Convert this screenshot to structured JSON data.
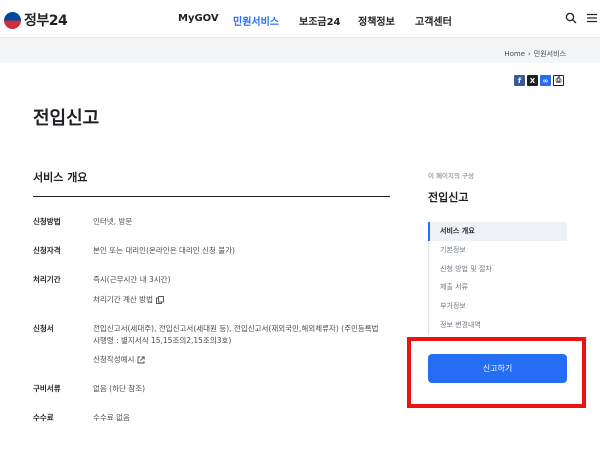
{
  "header": {
    "logo_text": "정부24",
    "nav": [
      "MyGOV",
      "민원서비스",
      "보조금24",
      "정책정보",
      "고객센터"
    ],
    "active_nav": "민원서비스",
    "icons": [
      "search-icon",
      "menu-icon"
    ]
  },
  "breadcrumb": [
    "Home",
    "민원서비스"
  ],
  "share_icons": [
    "facebook-icon",
    "x-icon",
    "link-icon",
    "print-icon"
  ],
  "page_title": "전입신고",
  "overview": {
    "section_title": "서비스 개요",
    "rows": [
      {
        "label": "신청방법",
        "value": "인터넷, 방문"
      },
      {
        "label": "신청자격",
        "value": "본인 또는 대리인(온라인은 대리인 신청 불가)"
      },
      {
        "label": "처리기간",
        "value": "즉시(근무시간 내 3시간)",
        "link": "처리기간 계산 방법"
      },
      {
        "label": "신청서",
        "value_line1": "전입신고서(세대주), 전입신고서(세대원 등), 전입신고서(재외국민,해외체류자) (주민등록법",
        "value_line2": "시행령 : 별지서식 15,15조의2,15조의3호)",
        "link": "신청작성예시"
      },
      {
        "label": "구비서류",
        "value": "없음 (하단 참조)"
      },
      {
        "label": "수수료",
        "value": "수수료 없음"
      }
    ]
  },
  "side": {
    "caption": "이 페이지의 구성",
    "title": "전입신고",
    "items": [
      "서비스 개요",
      "기본정보",
      "신청 방법 및 절차",
      "제출 서류",
      "부가정보",
      "정보 변경내역"
    ],
    "apply_button": "신고하기"
  },
  "colors": {
    "accent": "#256ef4",
    "highlight": "#ee1111"
  }
}
